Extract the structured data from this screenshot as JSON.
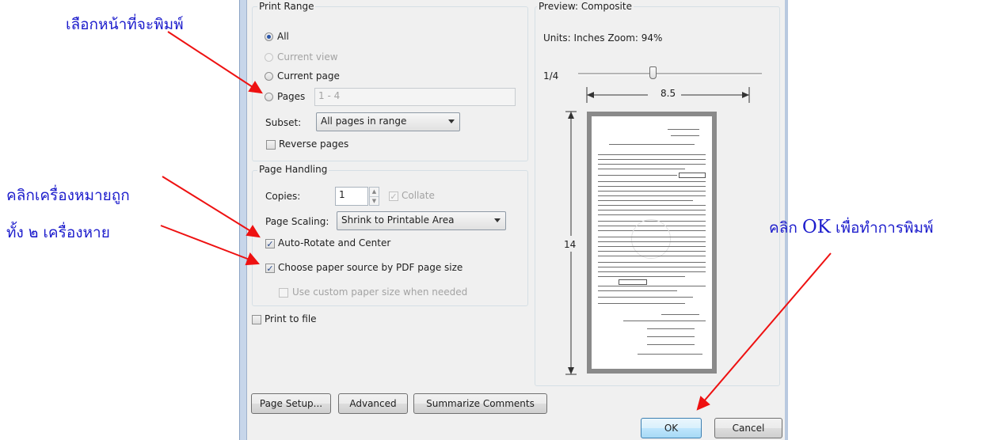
{
  "print_range": {
    "title": "Print Range",
    "all": "All",
    "current_view": "Current view",
    "current_page": "Current page",
    "pages": "Pages",
    "pages_value": "1 - 4",
    "subset_label": "Subset:",
    "subset_value": "All pages in range",
    "reverse_pages": "Reverse pages"
  },
  "page_handling": {
    "title": "Page Handling",
    "copies_label": "Copies:",
    "copies_value": "1",
    "collate": "Collate",
    "scaling_label": "Page Scaling:",
    "scaling_value": "Shrink to Printable Area",
    "auto_rotate": "Auto-Rotate and Center",
    "paper_source": "Choose paper source by PDF page size",
    "custom_paper": "Use custom paper size when needed"
  },
  "print_to_file": "Print to file",
  "preview": {
    "title": "Preview: Composite",
    "units": "Units: Inches Zoom:  94%",
    "page_indicator": "1/4",
    "width": "8.5",
    "height": "14"
  },
  "buttons": {
    "page_setup": "Page Setup...",
    "advanced": "Advanced",
    "summarize": "Summarize Comments",
    "ok": "OK",
    "cancel": "Cancel"
  },
  "annotations": {
    "select_pages": "เลือกหน้าที่จะพิมพ์",
    "check_marks_1": "คลิกเครื่องหมายถูก",
    "check_marks_2": "ทั้ง ๒ เครื่องหาย",
    "click_ok_prefix": "คลิก ",
    "click_ok_ok": "OK",
    "click_ok_suffix": " เพื่อทำการพิมพ์"
  },
  "colors": {
    "annotation": "#1c1ccc",
    "arrow": "#ee1111",
    "dialog_bg": "#f0f0f0"
  }
}
